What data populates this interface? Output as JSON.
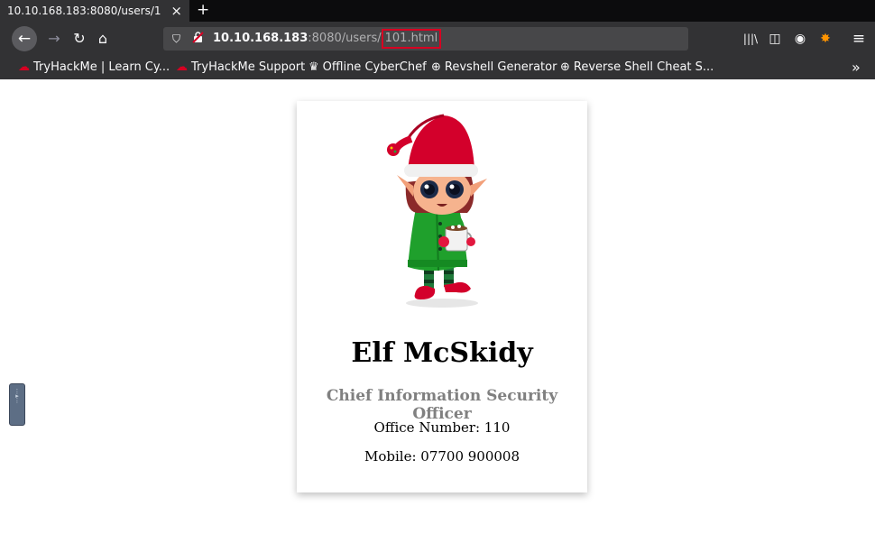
{
  "browser": {
    "tab": {
      "title": "10.10.168.183:8080/users/1",
      "close": "×"
    },
    "new_tab": "+",
    "nav": {
      "back": "←",
      "forward": "→",
      "reload": "↻",
      "home": "⌂"
    },
    "url": {
      "host": "10.10.168.183",
      "port_path": ":8080/users/",
      "highlighted": "101.html"
    },
    "url_actions": {
      "more": "···",
      "pocket": "⊠",
      "bookmark": "☆"
    },
    "toolbar_right": {
      "library": "|||\\",
      "sidebar": "◫",
      "account": "◉",
      "extension": "✸",
      "menu": "≡"
    },
    "bookmarks": [
      {
        "label": "TryHackMe | Learn Cy...",
        "icon": "cloud-icon"
      },
      {
        "label": "TryHackMe Support",
        "icon": "cloud-icon"
      },
      {
        "label": "Offline CyberChef",
        "icon": "chef-hat-icon"
      },
      {
        "label": "Revshell Generator",
        "icon": "globe-icon"
      },
      {
        "label": "Reverse Shell Cheat S...",
        "icon": "globe-icon"
      }
    ],
    "bookmarks_overflow": "»"
  },
  "profile": {
    "name": "Elf McSkidy",
    "title": "Chief Information Security Officer",
    "office": "Office Number: 110",
    "mobile": "Mobile: 07700 900008"
  },
  "colors": {
    "chrome_dark": "#0c0c0d",
    "chrome": "#323234",
    "url_highlight_border": "#d70022",
    "role_text": "#808080"
  }
}
